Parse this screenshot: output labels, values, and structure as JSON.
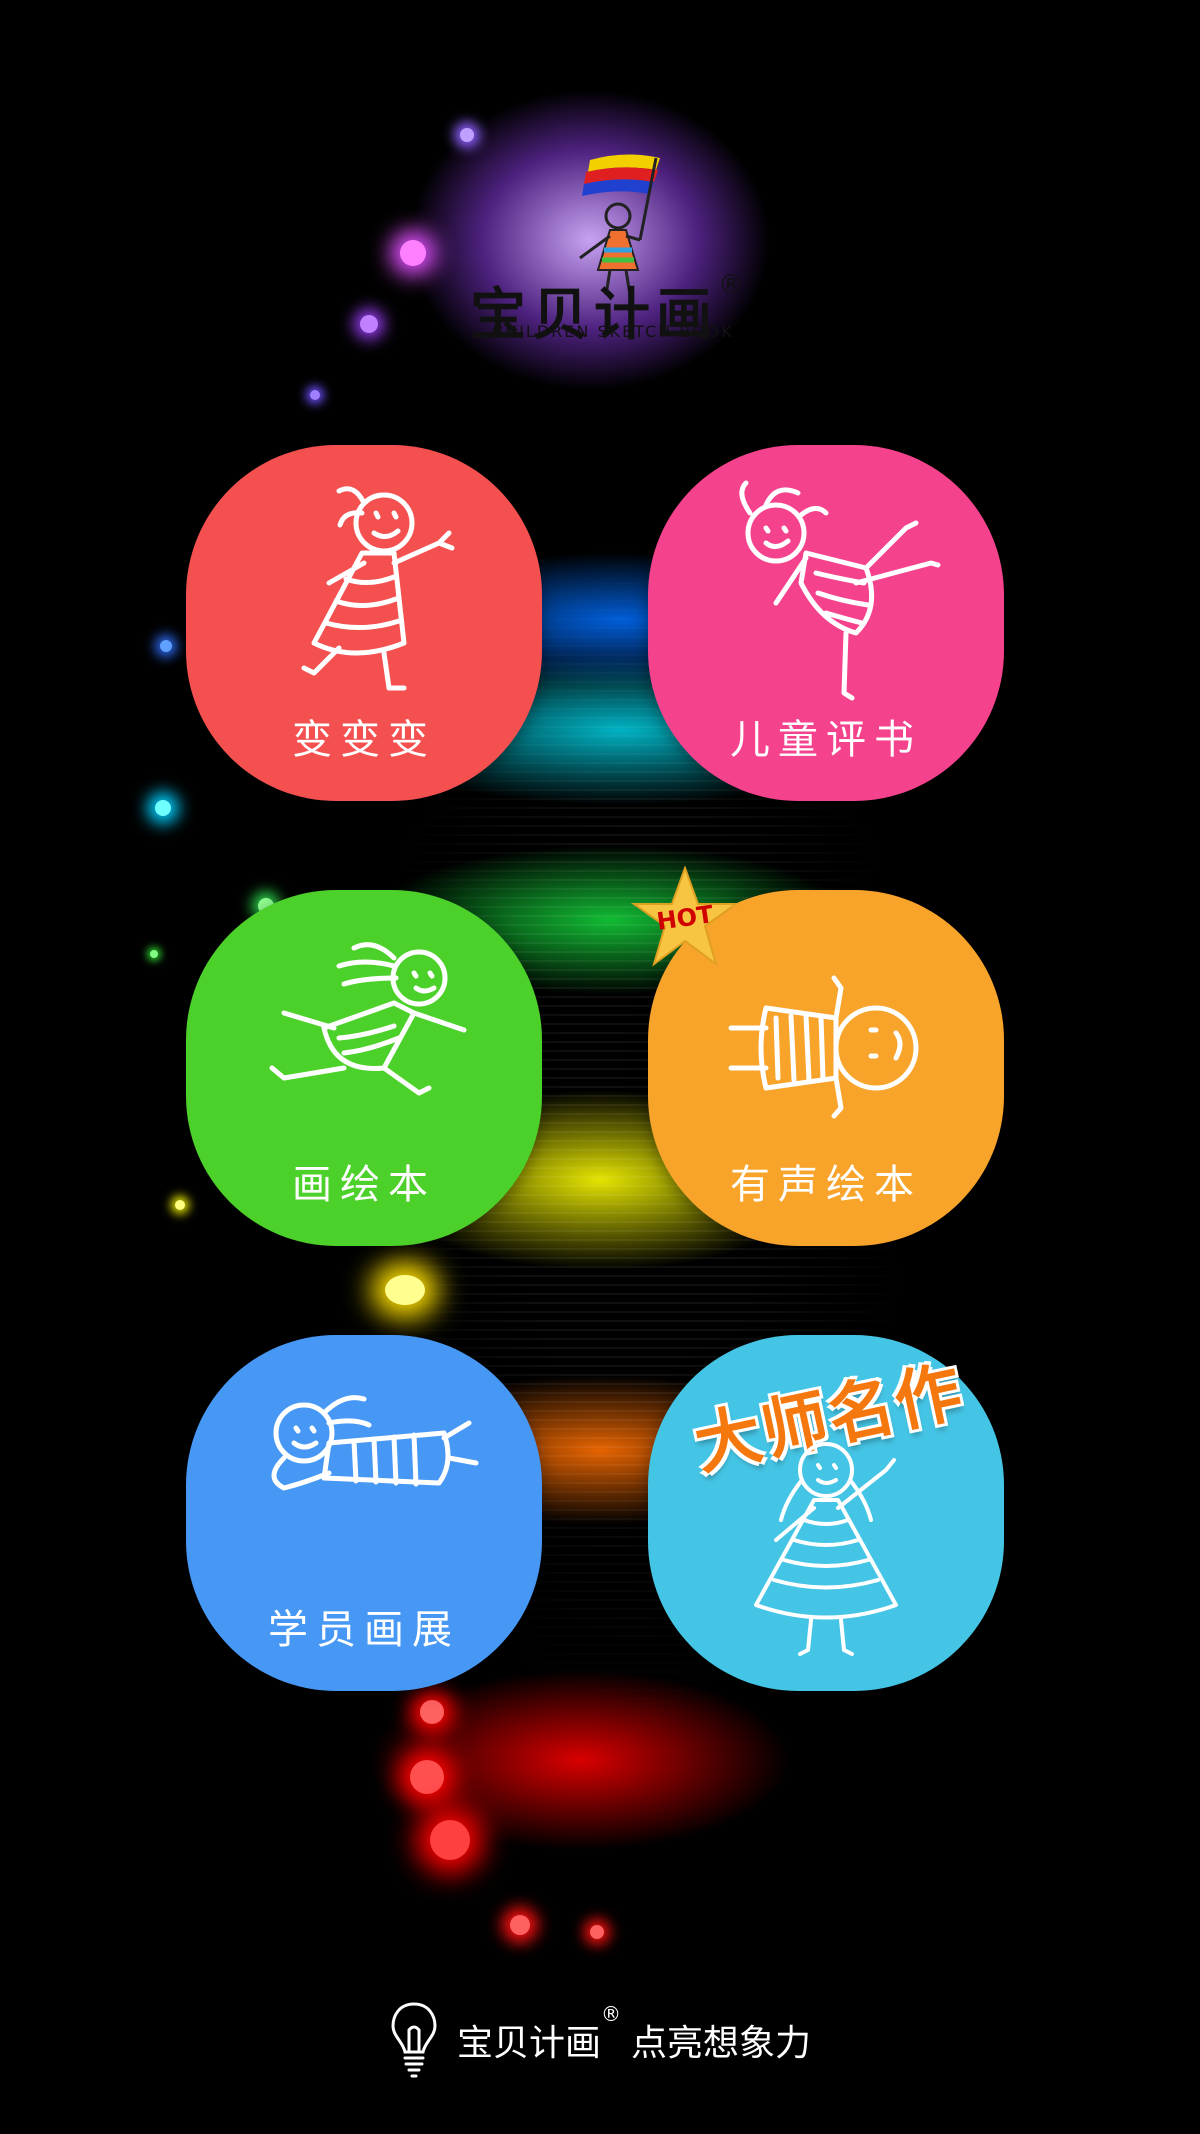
{
  "logo": {
    "brand": "宝贝计画",
    "reg_mark": "®",
    "subtitle": "CHILDREN SKETCH BOOK",
    "icon": "painter-girl-flag-icon"
  },
  "tiles": [
    {
      "label": "变变变",
      "color": "#f45050",
      "icon": "girl-dancing-icon"
    },
    {
      "label": "儿童评书",
      "color": "#f5428d",
      "icon": "girl-kicking-icon"
    },
    {
      "label": "画绘本",
      "color": "#4cd12a",
      "icon": "girl-running-icon"
    },
    {
      "label": "有声绘本",
      "color": "#f8a32a",
      "icon": "girl-lying-icon",
      "badge": "HOT"
    },
    {
      "label": "学员画展",
      "color": "#4798f5",
      "icon": "girl-prone-icon"
    },
    {
      "label": "大师名作",
      "color": "#45c5e5",
      "icon": "girl-waving-icon"
    }
  ],
  "footer": {
    "brand": "宝贝计画",
    "reg_mark": "®",
    "slogan": "点亮想象力",
    "icon": "lightbulb-icon"
  }
}
